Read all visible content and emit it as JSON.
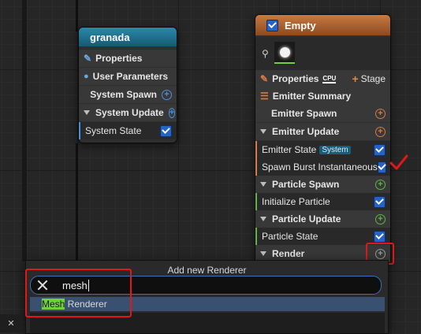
{
  "system_node": {
    "title": "granada",
    "rows": {
      "properties": "Properties",
      "user_parameters": "User Parameters",
      "system_spawn": "System Spawn",
      "system_update": "System Update",
      "system_state": "System State"
    }
  },
  "emitter_node": {
    "title": "Empty",
    "properties": "Properties",
    "cpu_badge": "CPU",
    "stage": "Stage",
    "emitter_summary": "Emitter Summary",
    "emitter_spawn": "Emitter Spawn",
    "emitter_update": "Emitter Update",
    "emitter_state": "Emitter State",
    "system_tag": "System",
    "spawn_burst": "Spawn Burst Instantaneous",
    "particle_spawn": "Particle Spawn",
    "initialize_particle": "Initialize Particle",
    "particle_update": "Particle Update",
    "particle_state": "Particle State",
    "render": "Render"
  },
  "renderer_popup": {
    "title": "Add new Renderer",
    "search_value": "mesh",
    "result_match": "Mesh",
    "result_rest": " Renderer"
  },
  "colors": {
    "system_header": "#1f6f8c",
    "emitter_header": "#b86a32",
    "checkbox": "#2563c5",
    "highlight": "#6fd23a",
    "annotation": "#e01818"
  }
}
